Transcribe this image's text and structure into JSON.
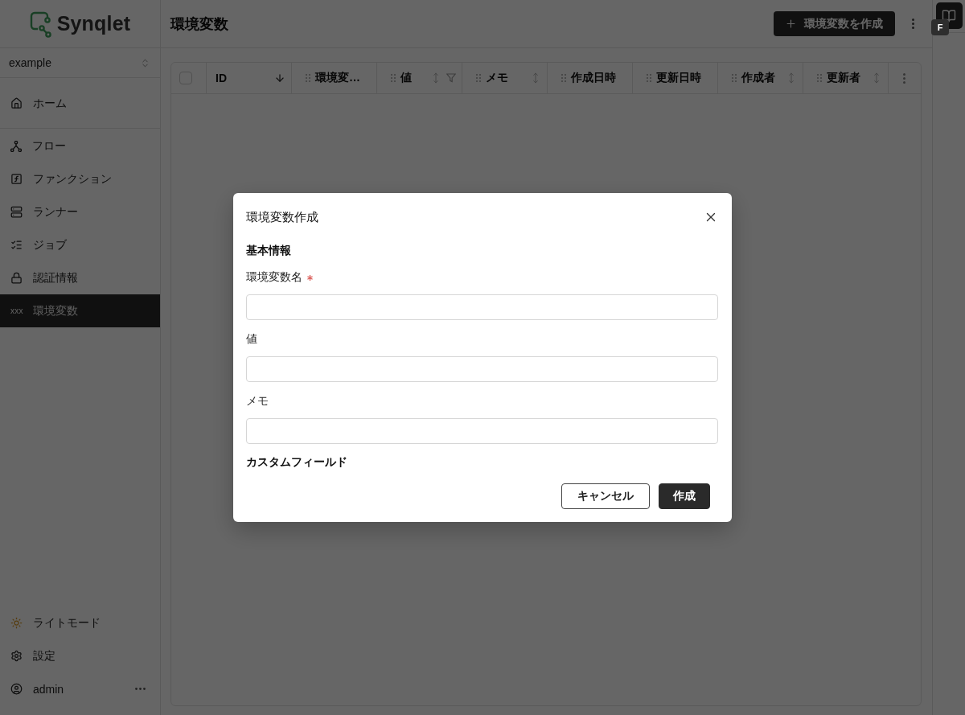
{
  "sidebar": {
    "logo": "Synqlet",
    "workspace": {
      "value": "example"
    },
    "nav_groups": [
      {
        "items": [
          {
            "label": "ホーム",
            "selected": false
          }
        ]
      },
      {
        "items": [
          {
            "label": "フロー",
            "selected": false
          },
          {
            "label": "ファンクション",
            "selected": false
          },
          {
            "label": "ランナー",
            "selected": false
          },
          {
            "label": "ジョブ",
            "selected": false
          },
          {
            "label": "認証情報",
            "selected": false
          },
          {
            "label": "環境変数",
            "icon_text": "xxx",
            "selected": true
          }
        ]
      }
    ],
    "footer_items": [
      {
        "label": "ライトモード"
      },
      {
        "label": "設定"
      }
    ],
    "user": {
      "name": "admin"
    }
  },
  "header": {
    "title": "環境変数",
    "create_button": "環境変数を作成"
  },
  "right_rail": {
    "badge": "F"
  },
  "table": {
    "select_all": {
      "checked": false
    },
    "columns": [
      {
        "label": "ID",
        "sorted": true,
        "filter": false
      },
      {
        "label": "環境変…",
        "filter": false
      },
      {
        "label": "値",
        "sorted": false,
        "filter": true
      },
      {
        "label": "メモ",
        "sorted": false,
        "filter": false
      },
      {
        "label": "作成日時",
        "filter": false
      },
      {
        "label": "更新日時",
        "filter": false
      },
      {
        "label": "作成者",
        "sorted": false,
        "filter": false
      },
      {
        "label": "更新者",
        "sorted": false,
        "filter": false
      }
    ]
  },
  "dialog": {
    "title": "環境変数作成",
    "sections": [
      {
        "heading": "基本情報",
        "fields": [
          {
            "label": "環境変数名",
            "required": true
          },
          {
            "label": "値",
            "required": false
          },
          {
            "label": "メモ",
            "required": false
          }
        ]
      },
      {
        "heading": "カスタムフィールド"
      }
    ],
    "buttons": [
      {
        "label": "キャンセル",
        "kind": "cancel"
      },
      {
        "label": "作成",
        "kind": "submit"
      }
    ]
  }
}
